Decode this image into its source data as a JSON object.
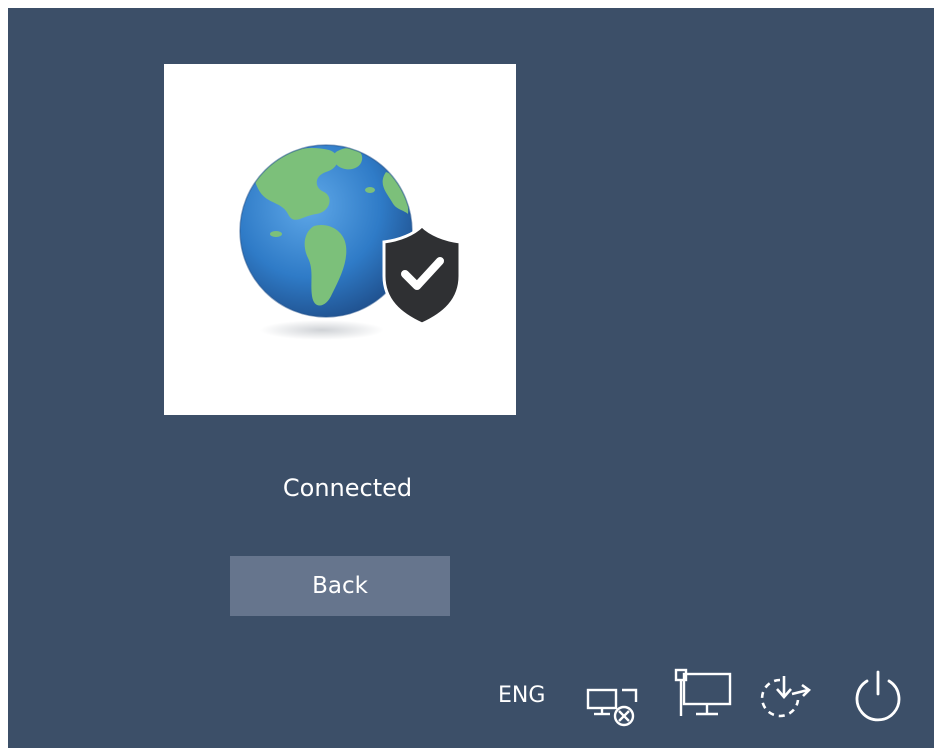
{
  "status": {
    "text": "Connected"
  },
  "actions": {
    "back_label": "Back"
  },
  "tray": {
    "language": "ENG",
    "icons": [
      "ease-of-access-icon",
      "network-icon",
      "update-and-restart-icon",
      "power-icon"
    ]
  },
  "colors": {
    "background": "#3c4f68",
    "button": "#66758d",
    "tile": "#ffffff",
    "text": "#ffffff",
    "ocean": "#2f7bc7",
    "land": "#7cc07a",
    "shield": "#2f3033"
  }
}
